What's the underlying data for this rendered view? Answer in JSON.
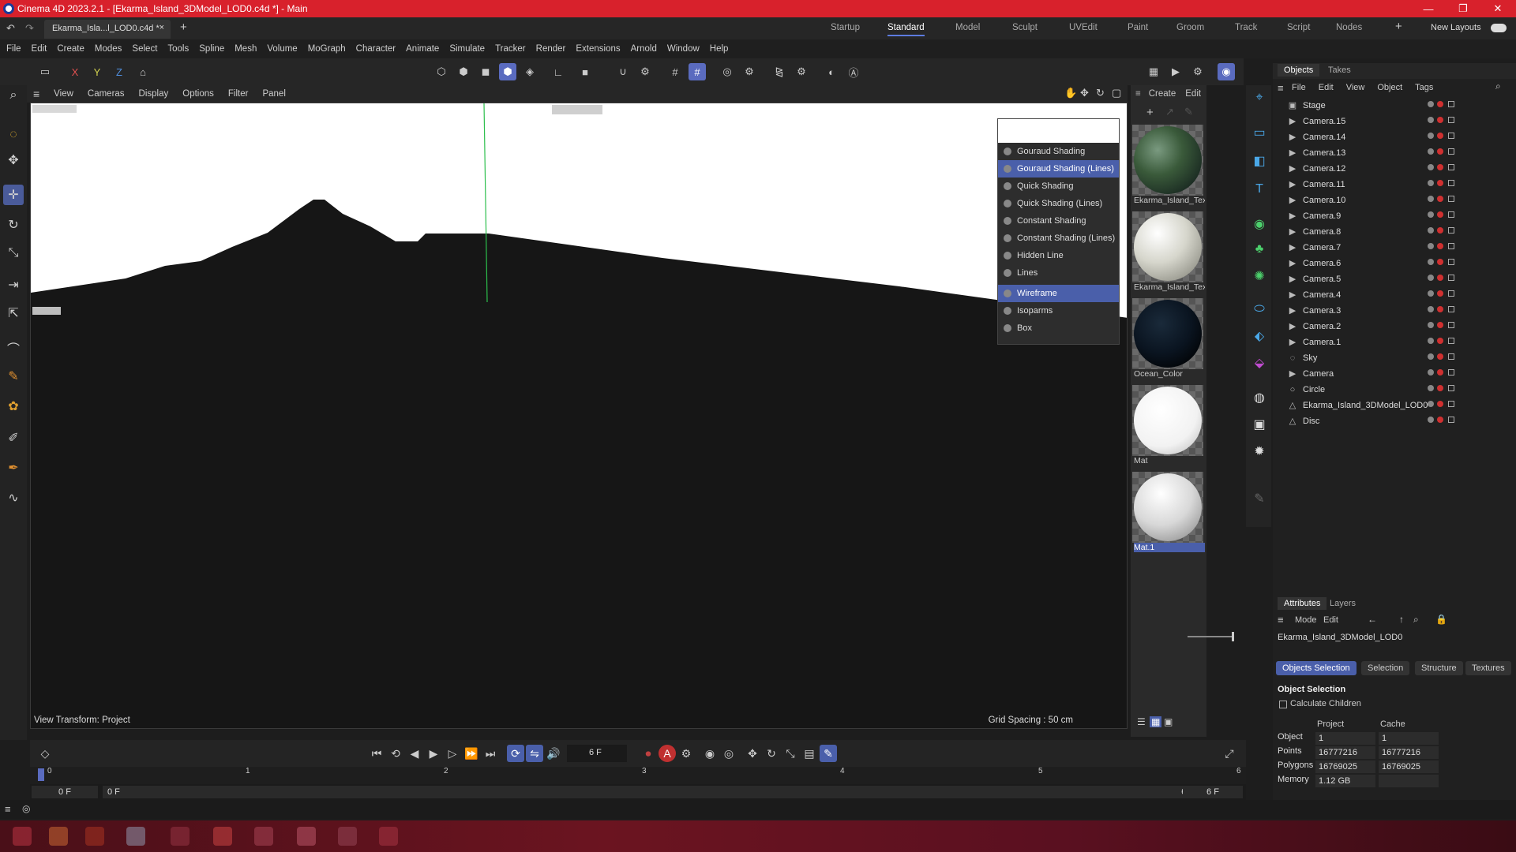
{
  "window": {
    "title": "Cinema 4D 2023.2.1 - [Ekarma_Island_3DModel_LOD0.c4d *] - Main",
    "minimize": "—",
    "maximize": "❐",
    "close": "✕"
  },
  "tabs": {
    "document": "Ekarma_Isla...l_LOD0.c4d *",
    "close": "×",
    "add": "+",
    "layouts": [
      "Startup",
      "Standard",
      "Model",
      "Sculpt",
      "UVEdit",
      "Paint",
      "Groom",
      "Track",
      "Script",
      "Nodes"
    ],
    "active_layout": "Standard",
    "new_layouts": "New Layouts"
  },
  "menu": [
    "File",
    "Edit",
    "Create",
    "Modes",
    "Select",
    "Tools",
    "Spline",
    "Mesh",
    "Volume",
    "MoGraph",
    "Character",
    "Animate",
    "Simulate",
    "Tracker",
    "Render",
    "Extensions",
    "Arnold",
    "Window",
    "Help"
  ],
  "axis": {
    "x": "X",
    "y": "Y",
    "z": "Z"
  },
  "viewport_menu": [
    "View",
    "Cameras",
    "Display",
    "Options",
    "Filter",
    "Panel"
  ],
  "viewport": {
    "view_transform": "View Transform: Project",
    "grid_spacing": "Grid Spacing : 50 cm",
    "horizon_color": "#151515",
    "sky_color": "#ffffff"
  },
  "display_menu": {
    "items": [
      {
        "label": "Gouraud Shading",
        "highlight": false
      },
      {
        "label": "Gouraud Shading (Lines)",
        "highlight": true
      },
      {
        "label": "Quick Shading",
        "highlight": false
      },
      {
        "label": "Quick Shading (Lines)",
        "highlight": false
      },
      {
        "label": "Constant Shading",
        "highlight": false
      },
      {
        "label": "Constant Shading (Lines)",
        "highlight": false
      },
      {
        "label": "Hidden Line",
        "highlight": false
      },
      {
        "label": "Lines",
        "highlight": false
      }
    ],
    "items2": [
      {
        "label": "Wireframe",
        "highlight": true
      },
      {
        "label": "Isoparms",
        "highlight": false
      },
      {
        "label": "Box",
        "highlight": false
      }
    ]
  },
  "materials": {
    "menu": [
      "Create",
      "Edit"
    ],
    "items": [
      {
        "label": "Ekarma_Island_Tex",
        "style": "earth"
      },
      {
        "label": "Ekarma_Island_Tex",
        "style": "snow"
      },
      {
        "label": "Ocean_Color",
        "style": "dark"
      },
      {
        "label": "Mat",
        "style": "white"
      },
      {
        "label": "Mat.1",
        "style": "grey"
      }
    ]
  },
  "objects": {
    "tabs": [
      "Objects",
      "Takes"
    ],
    "menu": [
      "File",
      "Edit",
      "View",
      "Object",
      "Tags"
    ],
    "rows": [
      {
        "name": "Stage",
        "icon": "stage-icon"
      },
      {
        "name": "Camera.15",
        "icon": "camera-icon"
      },
      {
        "name": "Camera.14",
        "icon": "camera-icon"
      },
      {
        "name": "Camera.13",
        "icon": "camera-icon"
      },
      {
        "name": "Camera.12",
        "icon": "camera-icon"
      },
      {
        "name": "Camera.11",
        "icon": "camera-icon"
      },
      {
        "name": "Camera.10",
        "icon": "camera-icon"
      },
      {
        "name": "Camera.9",
        "icon": "camera-icon"
      },
      {
        "name": "Camera.8",
        "icon": "camera-icon"
      },
      {
        "name": "Camera.7",
        "icon": "camera-icon"
      },
      {
        "name": "Camera.6",
        "icon": "camera-icon"
      },
      {
        "name": "Camera.5",
        "icon": "camera-icon"
      },
      {
        "name": "Camera.4",
        "icon": "camera-icon"
      },
      {
        "name": "Camera.3",
        "icon": "camera-icon"
      },
      {
        "name": "Camera.2",
        "icon": "camera-icon"
      },
      {
        "name": "Camera.1",
        "icon": "camera-icon"
      },
      {
        "name": "Sky",
        "icon": "sky-icon"
      },
      {
        "name": "Camera",
        "icon": "camera-icon"
      },
      {
        "name": "Circle",
        "icon": "circle-icon"
      },
      {
        "name": "Ekarma_Island_3DModel_LOD0",
        "icon": "polygon-object-icon"
      },
      {
        "name": "Disc",
        "icon": "polygon-object-icon"
      }
    ]
  },
  "attributes": {
    "tabs": [
      "Attributes",
      "Layers"
    ],
    "menu": [
      "Mode",
      "Edit"
    ],
    "object_name": "Ekarma_Island_3DModel_LOD0",
    "buttons": [
      "Objects Selection",
      "Selection",
      "Structure",
      "Textures"
    ],
    "section": "Object Selection",
    "calc_children": "Calculate Children",
    "col_project": "Project",
    "col_cache": "Cache",
    "rows": [
      {
        "label": "Object",
        "project": "1",
        "cache": "1"
      },
      {
        "label": "Points",
        "project": "16777216",
        "cache": "16777216"
      },
      {
        "label": "Polygons",
        "project": "16769025",
        "cache": "16769025"
      },
      {
        "label": "Memory",
        "project": "1.12 GB",
        "cache": ""
      }
    ]
  },
  "transport": {
    "current_frame": "6 F",
    "auto_key": "A"
  },
  "timeline": {
    "ticks": [
      "0",
      "1",
      "2",
      "3",
      "4",
      "5",
      "6"
    ],
    "start": "0 F",
    "range_start": "0 F",
    "range_end": "6 F",
    "end": "6 F"
  }
}
